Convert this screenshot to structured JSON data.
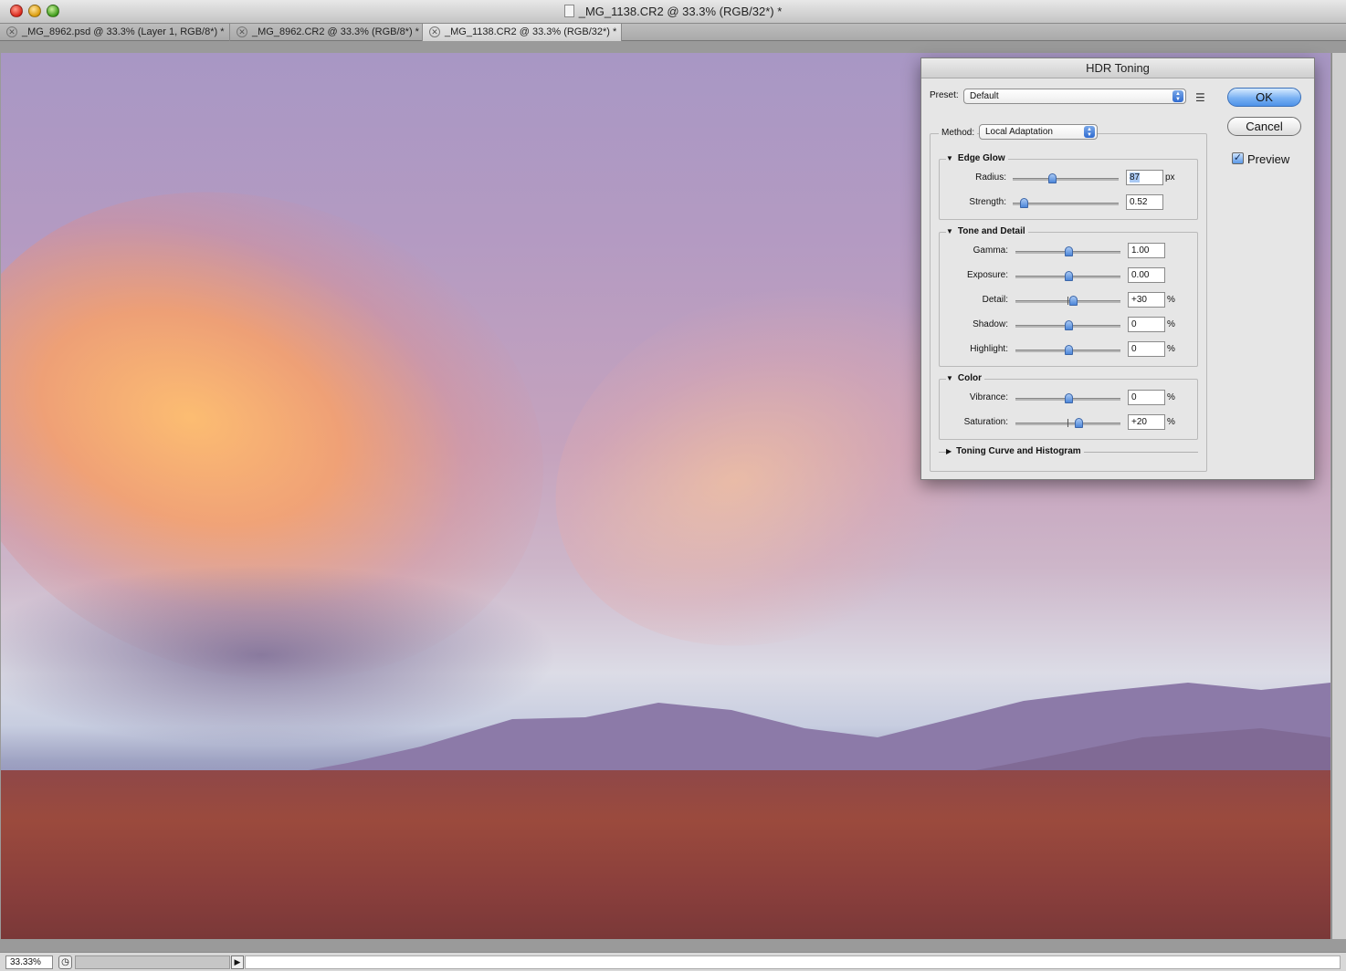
{
  "window": {
    "title": "_MG_1138.CR2 @ 33.3% (RGB/32*) *",
    "tabs": [
      {
        "label": "_MG_8962.psd @ 33.3% (Layer 1, RGB/8*) *",
        "active": false
      },
      {
        "label": "_MG_8962.CR2 @ 33.3% (RGB/8*) *",
        "active": false
      },
      {
        "label": "_MG_1138.CR2 @ 33.3% (RGB/32*) *",
        "active": true
      }
    ]
  },
  "status": {
    "zoom": "33.33%"
  },
  "dialog": {
    "title": "HDR Toning",
    "preset_label": "Preset:",
    "preset_value": "Default",
    "method_label": "Method:",
    "method_value": "Local Adaptation",
    "ok_label": "OK",
    "cancel_label": "Cancel",
    "preview_label": "Preview",
    "preview_checked": true,
    "edge_glow": {
      "title": "Edge Glow",
      "radius": {
        "label": "Radius:",
        "value": "87",
        "unit": "px",
        "slider_fraction": 0.37
      },
      "strength": {
        "label": "Strength:",
        "value": "0.52",
        "unit": "",
        "slider_fraction": 0.1
      }
    },
    "tone_detail": {
      "title": "Tone and Detail",
      "gamma": {
        "label": "Gamma:",
        "value": "1.00",
        "unit": "",
        "slider_fraction": 0.5
      },
      "exposure": {
        "label": "Exposure:",
        "value": "0.00",
        "unit": "",
        "slider_fraction": 0.5
      },
      "detail": {
        "label": "Detail:",
        "value": "+30",
        "unit": "%",
        "slider_fraction": 0.55
      },
      "shadow": {
        "label": "Shadow:",
        "value": "0",
        "unit": "%",
        "slider_fraction": 0.5
      },
      "highlight": {
        "label": "Highlight:",
        "value": "0",
        "unit": "%",
        "slider_fraction": 0.5
      }
    },
    "color": {
      "title": "Color",
      "vibrance": {
        "label": "Vibrance:",
        "value": "0",
        "unit": "%",
        "slider_fraction": 0.5
      },
      "saturation": {
        "label": "Saturation:",
        "value": "+20",
        "unit": "%",
        "slider_fraction": 0.6
      }
    },
    "curve_section": {
      "title": "Toning Curve and Histogram"
    }
  }
}
